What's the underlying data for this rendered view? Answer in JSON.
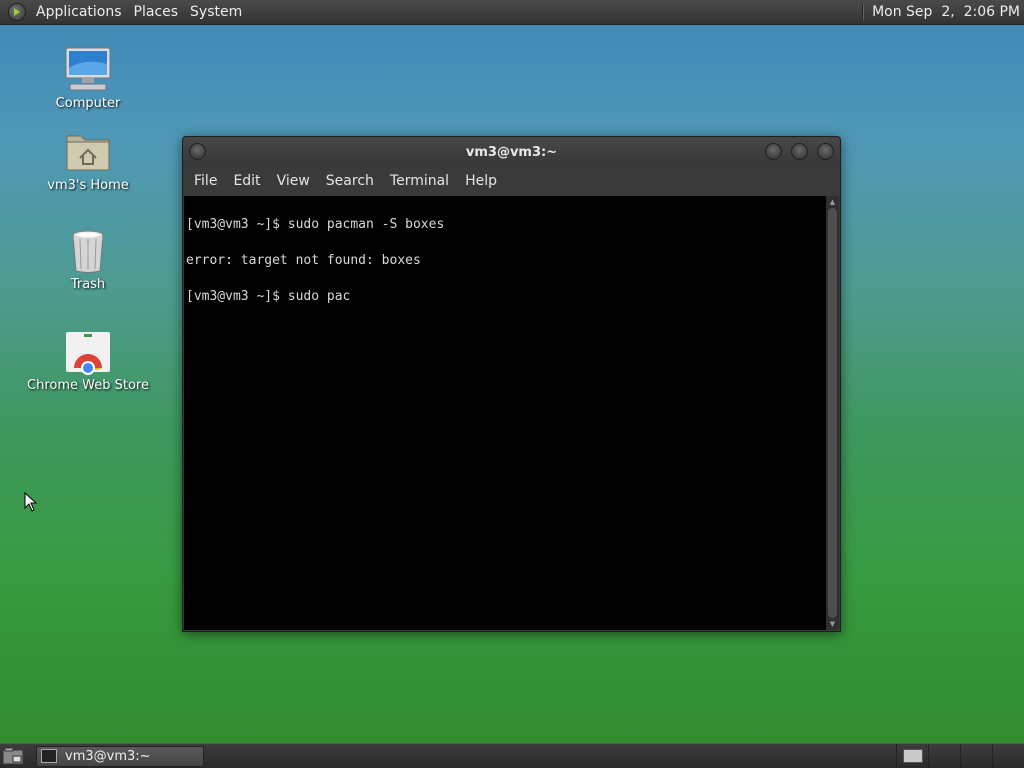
{
  "top_panel": {
    "menus": [
      "Applications",
      "Places",
      "System"
    ],
    "clock": "Mon Sep  2,  2:06 PM"
  },
  "desktop_icons": [
    {
      "label": "Computer",
      "icon": "computer-icon"
    },
    {
      "label": "vm3's Home",
      "icon": "home-folder-icon"
    },
    {
      "label": "Trash",
      "icon": "trash-icon"
    },
    {
      "label": "Chrome Web Store",
      "icon": "chrome-web-store-icon"
    }
  ],
  "terminal": {
    "title": "vm3@vm3:~",
    "menus": [
      "File",
      "Edit",
      "View",
      "Search",
      "Terminal",
      "Help"
    ],
    "lines": [
      "[vm3@vm3 ~]$ sudo pacman -S boxes",
      "error: target not found: boxes",
      "[vm3@vm3 ~]$ sudo pac"
    ]
  },
  "taskbar": {
    "task_label": "vm3@vm3:~",
    "workspaces": 4,
    "active_workspace": 1
  }
}
